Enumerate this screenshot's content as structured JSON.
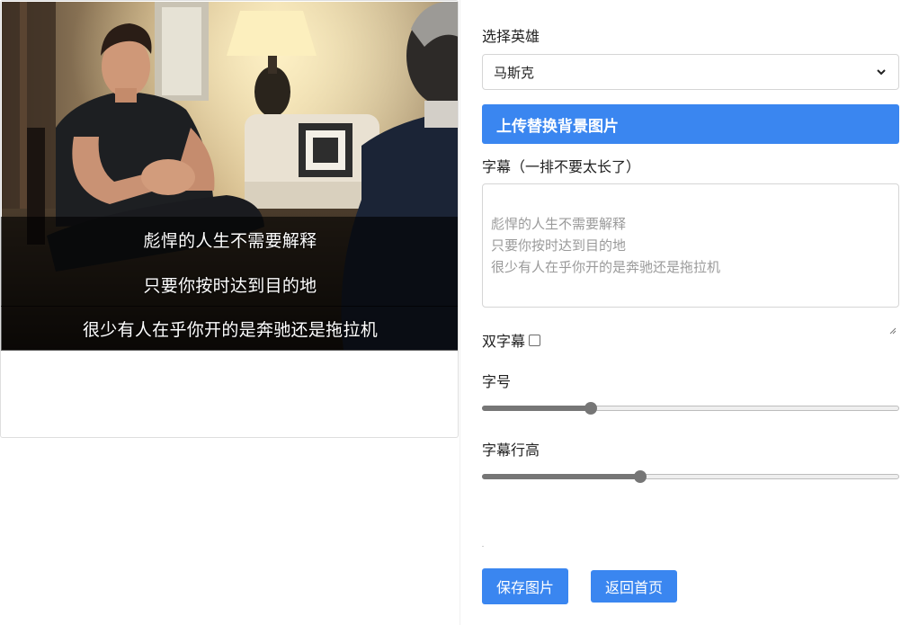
{
  "preview": {
    "subtitle_lines": [
      "彪悍的人生不需要解释",
      "只要你按时达到目的地",
      "很少有人在乎你开的是奔驰还是拖拉机"
    ]
  },
  "form": {
    "hero_label": "选择英雄",
    "hero_selected": "马斯克",
    "upload_label": "上传替换背景图片",
    "subtitle_label": "字幕（一排不要太长了）",
    "subtitle_placeholder": "彪悍的人生不需要解释\n只要你按时达到目的地\n很少有人在乎你开的是奔驰还是拖拉机",
    "double_subtitle_label": "双字幕",
    "double_subtitle_checked": false,
    "font_size_label": "字号",
    "font_size_level": 0.26,
    "line_height_label": "字幕行高",
    "line_height_level": 0.38,
    "save_button": "保存图片",
    "home_button": "返回首页"
  },
  "colors": {
    "accent": "#3a86f0",
    "slider": "#767676"
  },
  "icons": {
    "select_arrow": "chevron-down-icon",
    "resize": "resize-grip-icon"
  }
}
